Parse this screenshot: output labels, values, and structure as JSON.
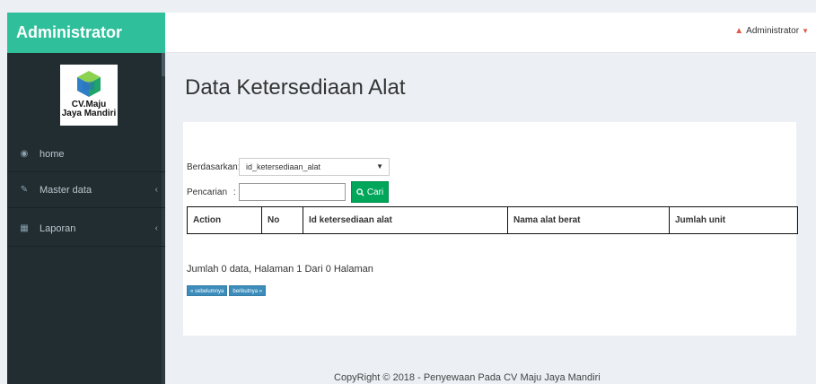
{
  "app": {
    "name": "Administrator"
  },
  "topbar": {
    "user_label": "Administrator"
  },
  "sidebar": {
    "brand": {
      "line1": "CV.Maju",
      "line2": "Jaya Mandiri"
    },
    "items": [
      {
        "label": "home",
        "icon": "dashboard-icon",
        "has_children": false
      },
      {
        "label": "Master data",
        "icon": "edit-icon",
        "has_children": true
      },
      {
        "label": "Laporan",
        "icon": "bar-chart-icon",
        "has_children": true
      }
    ]
  },
  "page": {
    "title": "Data Ketersediaan Alat"
  },
  "filter": {
    "by_label": "Berdasarkan:",
    "selected": "id_ketersediaan_alat",
    "search_label": "Pencarian",
    "search_sep": ":",
    "search_value": "",
    "search_button": "Cari"
  },
  "table": {
    "headers": [
      "Action",
      "No",
      "Id ketersediaan alat",
      "Nama alat berat",
      "Jumlah unit"
    ],
    "rows": []
  },
  "summary": "Jumlah 0 data, Halaman 1 Dari 0 Halaman",
  "pager": {
    "prev": "« sebelumnya",
    "next": "berikutnya »"
  },
  "footer": "CopyRight © 2018 - Penyewaan Pada CV Maju Jaya Mandiri",
  "colors": {
    "accent": "#2fbf9b",
    "sidebar": "#222d32",
    "button_green": "#00a65a",
    "button_blue": "#3c8dbc"
  }
}
